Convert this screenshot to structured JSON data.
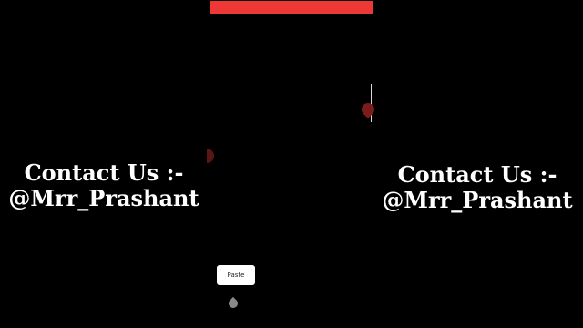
{
  "colors": {
    "background": "#000000",
    "top_bar": "#ee3835",
    "text": "#ffffff",
    "paste_bg": "#ffffff"
  },
  "left_overlay": {
    "line1": "Contact Us :-",
    "line2": "@Mrr_Prashant"
  },
  "right_overlay": {
    "line1": "Contact Us :-",
    "line2": "@Mrr_Prashant"
  },
  "context_menu": {
    "paste_label": "Paste"
  },
  "icons": {
    "selection_start": "text-selection-handle-icon",
    "selection_end": "text-selection-handle-icon",
    "insertion": "text-insertion-handle-icon"
  }
}
